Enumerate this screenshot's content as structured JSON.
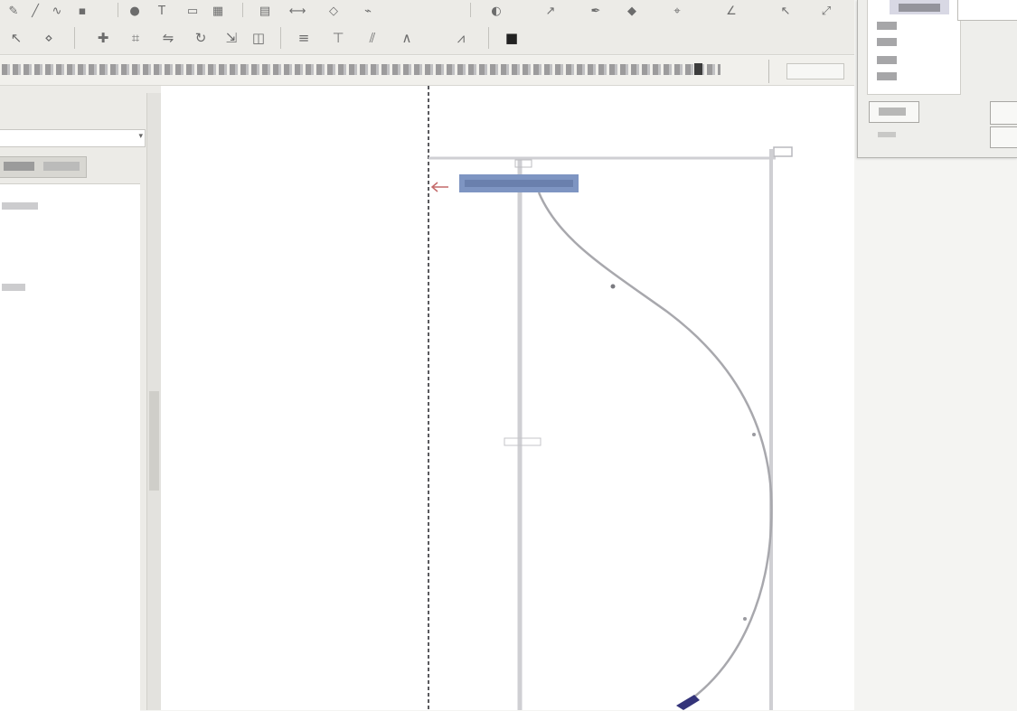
{
  "toolbar_row1": {
    "icons": [
      "draw-icon",
      "line-icon",
      "curve-icon",
      "bold-icon",
      "dot-icon",
      "text-icon",
      "rect-icon",
      "grid-icon",
      "table-icon",
      "measure-icon",
      "shape-icon",
      "link-icon",
      "fill-icon",
      "arrow-icon",
      "pen-icon",
      "zoom-icon",
      "target-icon"
    ]
  },
  "toolbar_row2": {
    "icons": [
      "select-icon",
      "node-icon",
      "add-node-icon",
      "pattern-icon",
      "mirror-icon",
      "rotate-icon",
      "scale-icon",
      "layer-icon",
      "grade-icon",
      "notch-icon",
      "seam-icon",
      "dart-icon",
      "pleat-icon",
      "mark-icon"
    ]
  },
  "prompt": {
    "text": ""
  },
  "left_panel": {
    "combo_value": "",
    "tab_label": ""
  },
  "canvas": {
    "selected_label": "",
    "top_marker": "",
    "mid_marker": ""
  },
  "popup": {
    "items": [
      "",
      "",
      "",
      ""
    ],
    "ok_label": ""
  },
  "colors": {
    "selection": "#7e95c2",
    "curve": "#a8a8ad",
    "guide": "#cfcfd3",
    "endpoint": "#34347a"
  }
}
